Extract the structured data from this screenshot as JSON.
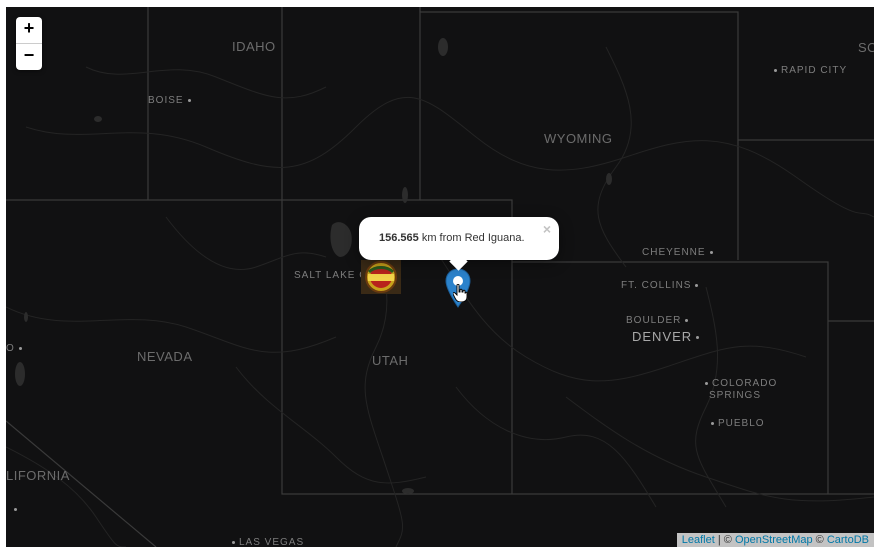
{
  "map": {
    "state_labels": [
      "IDAHO",
      "WYOMING",
      "NEVADA",
      "UTAH",
      "SO",
      "LIFORNIA"
    ],
    "city_labels": [
      "BOISE",
      "RAPID CITY",
      "SALT LAKE CI",
      "CHEYENNE",
      "FT. COLLINS",
      "BOULDER",
      "DENVER",
      "COLORADO",
      "SPRINGS",
      "PUEBLO",
      "LAS VEGAS",
      "O"
    ],
    "zoom_in": "+",
    "zoom_out": "−",
    "attribution": {
      "leaflet": "Leaflet",
      "sep1": " | © ",
      "osm": "OpenStreetMap",
      "sep2": " © ",
      "carto": "CartoDB"
    },
    "popup": {
      "distance": "156.565",
      "text": " km from Red Iguana.",
      "close": "×"
    },
    "restaurant_badge_text": "RED IGUANA",
    "colors": {
      "background": "#111112",
      "marker": "#2b82cb",
      "link": "#0078a8"
    }
  }
}
